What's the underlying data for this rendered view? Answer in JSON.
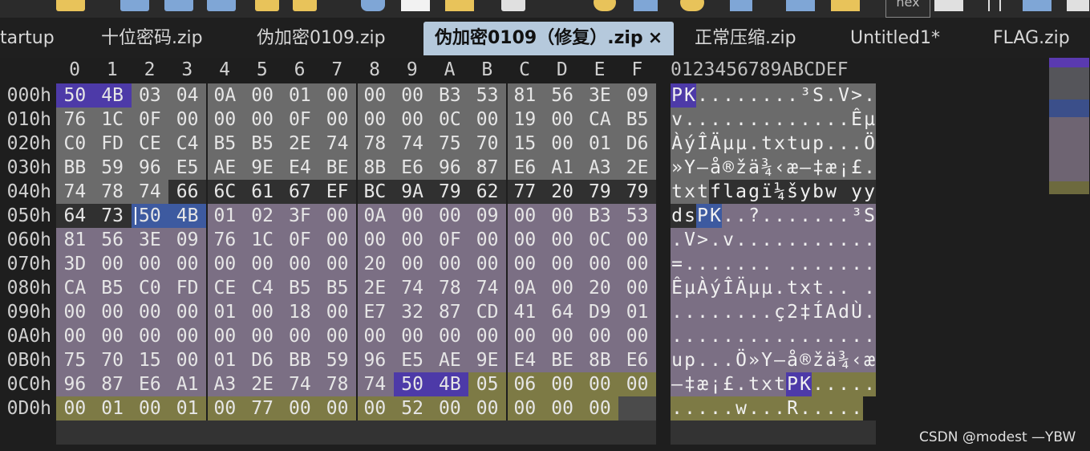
{
  "colors": {
    "bg_gray": "#6b6b6b",
    "bg_dark": "#303030",
    "bg_purple": "#7b6f84",
    "bg_olive": "#7d7a45",
    "sel_purple": "#4d3aa8",
    "sel_blue": "#3d5aa0"
  },
  "tabs": [
    {
      "label": "tartup"
    },
    {
      "label": "十位密码.zip"
    },
    {
      "label": "伪加密0109.zip"
    },
    {
      "label": "伪加密0109（修复）.zip",
      "active": true
    },
    {
      "label": "正常压缩.zip"
    },
    {
      "label": "Untitled1*"
    },
    {
      "label": "FLAG.zip"
    }
  ],
  "tab_close_glyph": "×",
  "toolbar_partial_label": "hex",
  "hex_header": [
    "0",
    "1",
    "2",
    "3",
    "4",
    "5",
    "6",
    "7",
    "8",
    "9",
    "A",
    "B",
    "C",
    "D",
    "E",
    "F"
  ],
  "ascii_header": "0123456789ABCDEF",
  "offsets": [
    "000h",
    "010h",
    "020h",
    "030h",
    "040h",
    "050h",
    "060h",
    "070h",
    "080h",
    "090h",
    "0A0h",
    "0B0h",
    "0C0h",
    "0D0h"
  ],
  "rows": [
    {
      "bytes": [
        "50",
        "4B",
        "03",
        "04",
        "0A",
        "00",
        "01",
        "00",
        "00",
        "00",
        "B3",
        "53",
        "81",
        "56",
        "3E",
        "09"
      ],
      "ascii": "PK........³S.V>."
    },
    {
      "bytes": [
        "76",
        "1C",
        "0F",
        "00",
        "00",
        "00",
        "0F",
        "00",
        "00",
        "00",
        "0C",
        "00",
        "19",
        "00",
        "CA",
        "B5"
      ],
      "ascii": "v.............Êµ"
    },
    {
      "bytes": [
        "C0",
        "FD",
        "CE",
        "C4",
        "B5",
        "B5",
        "2E",
        "74",
        "78",
        "74",
        "75",
        "70",
        "15",
        "00",
        "01",
        "D6"
      ],
      "ascii": "ÀýÎÄµµ.txtup...Ö"
    },
    {
      "bytes": [
        "BB",
        "59",
        "96",
        "E5",
        "AE",
        "9E",
        "E4",
        "BE",
        "8B",
        "E6",
        "96",
        "87",
        "E6",
        "A1",
        "A3",
        "2E"
      ],
      "ascii": "»Y–å®žä¾‹æ–‡æ¡£."
    },
    {
      "bytes": [
        "74",
        "78",
        "74",
        "66",
        "6C",
        "61",
        "67",
        "EF",
        "BC",
        "9A",
        "79",
        "62",
        "77",
        "20",
        "79",
        "79"
      ],
      "ascii": "txtflagï¼šybw yy"
    },
    {
      "bytes": [
        "64",
        "73",
        "50",
        "4B",
        "01",
        "02",
        "3F",
        "00",
        "0A",
        "00",
        "00",
        "09",
        "00",
        "00",
        "B3",
        "53"
      ],
      "ascii": "dsPK..?.......³S"
    },
    {
      "bytes": [
        "81",
        "56",
        "3E",
        "09",
        "76",
        "1C",
        "0F",
        "00",
        "00",
        "00",
        "0F",
        "00",
        "00",
        "00",
        "0C",
        "00"
      ],
      "ascii": ".V>.v..........."
    },
    {
      "bytes": [
        "3D",
        "00",
        "00",
        "00",
        "00",
        "00",
        "00",
        "00",
        "20",
        "00",
        "00",
        "00",
        "00",
        "00",
        "00",
        "00"
      ],
      "ascii": "=....... ......."
    },
    {
      "bytes": [
        "CA",
        "B5",
        "C0",
        "FD",
        "CE",
        "C4",
        "B5",
        "B5",
        "2E",
        "74",
        "78",
        "74",
        "0A",
        "00",
        "20",
        "00"
      ],
      "ascii": "ÊµÀýÎÄµµ.txt.. ."
    },
    {
      "bytes": [
        "00",
        "00",
        "00",
        "00",
        "01",
        "00",
        "18",
        "00",
        "E7",
        "32",
        "87",
        "CD",
        "41",
        "64",
        "D9",
        "01"
      ],
      "ascii": "........ç2‡ÍAdÙ."
    },
    {
      "bytes": [
        "00",
        "00",
        "00",
        "00",
        "00",
        "00",
        "00",
        "00",
        "00",
        "00",
        "00",
        "00",
        "00",
        "00",
        "00",
        "00"
      ],
      "ascii": "................"
    },
    {
      "bytes": [
        "75",
        "70",
        "15",
        "00",
        "01",
        "D6",
        "BB",
        "59",
        "96",
        "E5",
        "AE",
        "9E",
        "E4",
        "BE",
        "8B",
        "E6"
      ],
      "ascii": "up...Ö»Y–å®žä¾‹æ"
    },
    {
      "bytes": [
        "96",
        "87",
        "E6",
        "A1",
        "A3",
        "2E",
        "74",
        "78",
        "74",
        "50",
        "4B",
        "05",
        "06",
        "00",
        "00",
        "00"
      ],
      "ascii": "–‡æ¡£.txtPK....."
    },
    {
      "bytes": [
        "00",
        "01",
        "00",
        "01",
        "00",
        "77",
        "00",
        "00",
        "00",
        "52",
        "00",
        "00",
        "00",
        "00",
        "00"
      ],
      "ascii": ".....w...R....."
    }
  ],
  "watermark": "CSDN @modest —YBW"
}
